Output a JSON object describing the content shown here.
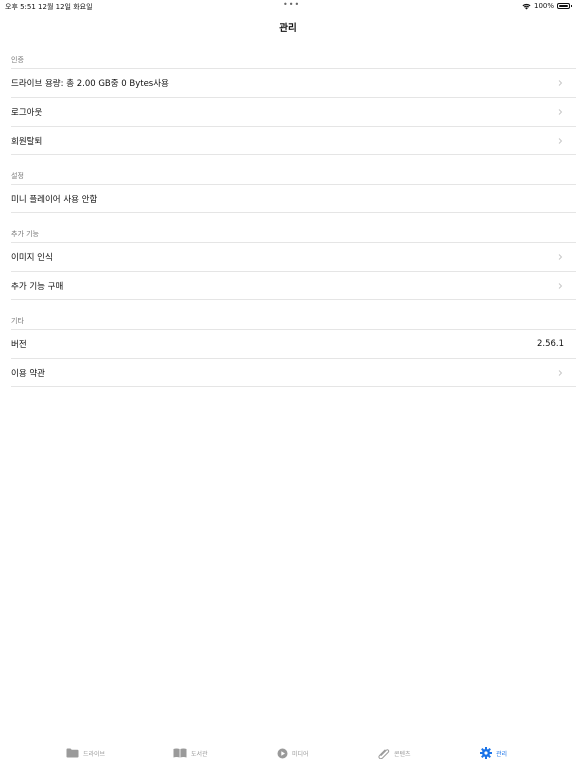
{
  "status_bar": {
    "time_date": "오후 5:51   12월 12일 화요일",
    "dots": "•••",
    "battery": "100%"
  },
  "nav": {
    "title": "관리"
  },
  "sections": [
    {
      "header": "인증",
      "rows": [
        {
          "label": "드라이브 용량: 총 2.00 GB중 0 Bytes사용",
          "chevron": true
        },
        {
          "label": "로그아웃",
          "chevron": true
        },
        {
          "label": "회원탈퇴",
          "chevron": true
        }
      ]
    },
    {
      "header": "설정",
      "rows": [
        {
          "label": "미니 플레이어 사용 안함",
          "chevron": false
        }
      ]
    },
    {
      "header": "추가 기능",
      "rows": [
        {
          "label": "이미지 인식",
          "chevron": true
        },
        {
          "label": "추가 기능 구매",
          "chevron": true
        }
      ]
    },
    {
      "header": "기타",
      "rows": [
        {
          "label": "버전",
          "value": "2.56.1",
          "chevron": false
        },
        {
          "label": "이용 약관",
          "chevron": true
        }
      ]
    }
  ],
  "tabs": [
    {
      "label": "드라이브",
      "icon": "folder-icon",
      "active": false
    },
    {
      "label": "도서관",
      "icon": "book-icon",
      "active": false
    },
    {
      "label": "미디어",
      "icon": "play-icon",
      "active": false
    },
    {
      "label": "콘텐츠",
      "icon": "paperclip-icon",
      "active": false
    },
    {
      "label": "관리",
      "icon": "gear-icon",
      "active": true
    }
  ],
  "colors": {
    "accent": "#1a73e8",
    "inactive_tab": "#9a9a9a",
    "separator": "#e5e5e5"
  }
}
